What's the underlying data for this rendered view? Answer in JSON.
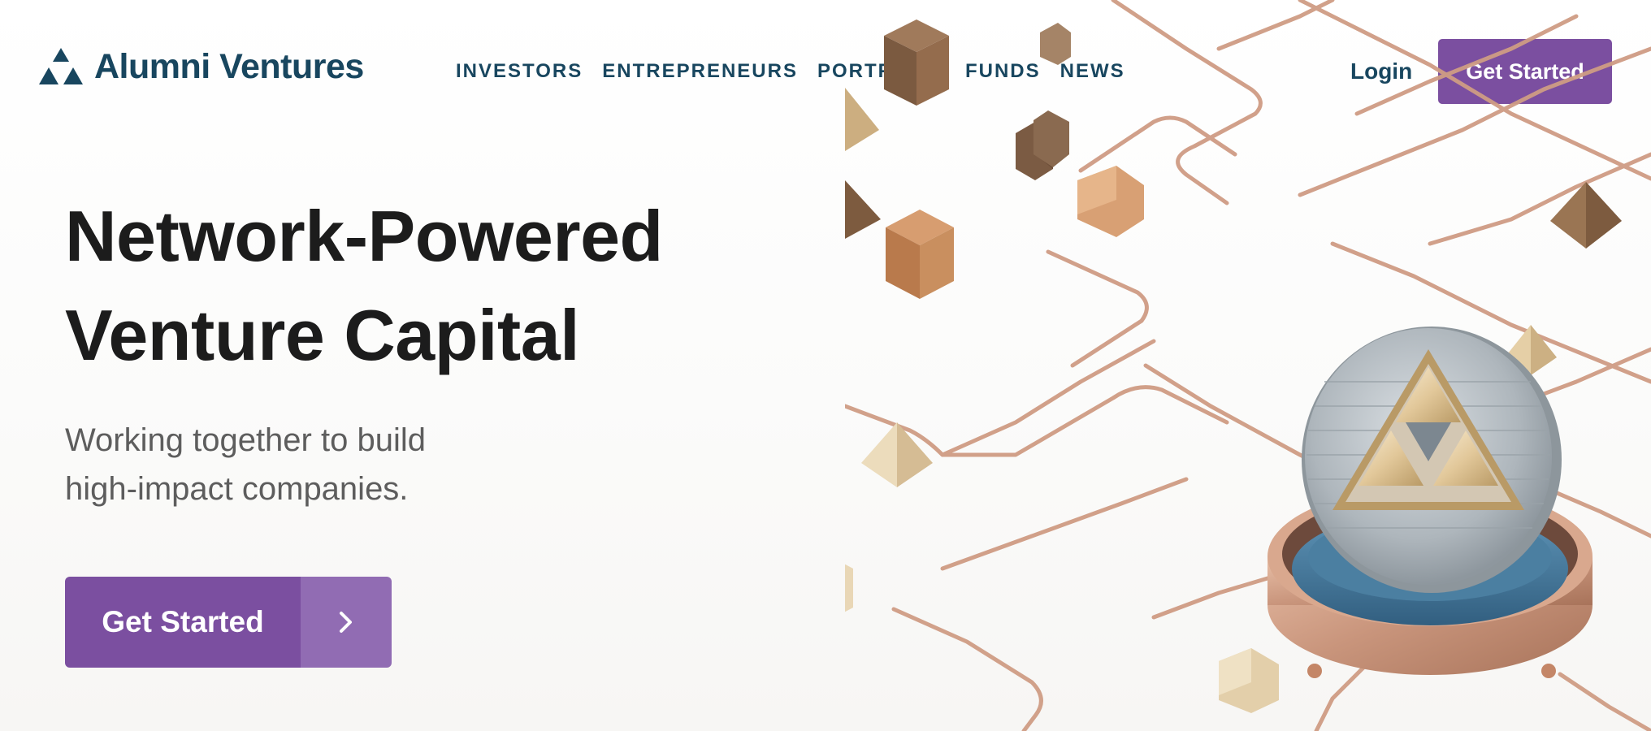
{
  "brand": {
    "name": "Alumni Ventures",
    "logo_icon": "triple-triangle-logo-icon",
    "color": "#18465f"
  },
  "nav": {
    "items": [
      {
        "label": "INVESTORS"
      },
      {
        "label": "ENTREPRENEURS"
      },
      {
        "label": "PORTFOLIO"
      },
      {
        "label": "FUNDS"
      },
      {
        "label": "NEWS"
      }
    ],
    "login_label": "Login",
    "cta_label": "Get Started"
  },
  "hero": {
    "title_lines": [
      "Network-Powered",
      "Venture Capital"
    ],
    "subtitle_lines": [
      "Working together to build",
      "high-impact companies."
    ],
    "cta_label": "Get Started",
    "cta_icon": "chevron-right-icon"
  },
  "illustration": {
    "description_icon": "network-blocks-coin-illustration"
  },
  "colors": {
    "accent": "#7b4fa0",
    "accent_light": "#916cb3",
    "nav_text": "#18465f",
    "title_text": "#1c1c1c",
    "subtitle_text": "#5d5d5d",
    "copper": "#c9957c",
    "wood_light": "#e7d2ad",
    "wood_mid": "#c98f5f",
    "wood_dark": "#8a6546",
    "coin_base": "#4b7fa1"
  }
}
